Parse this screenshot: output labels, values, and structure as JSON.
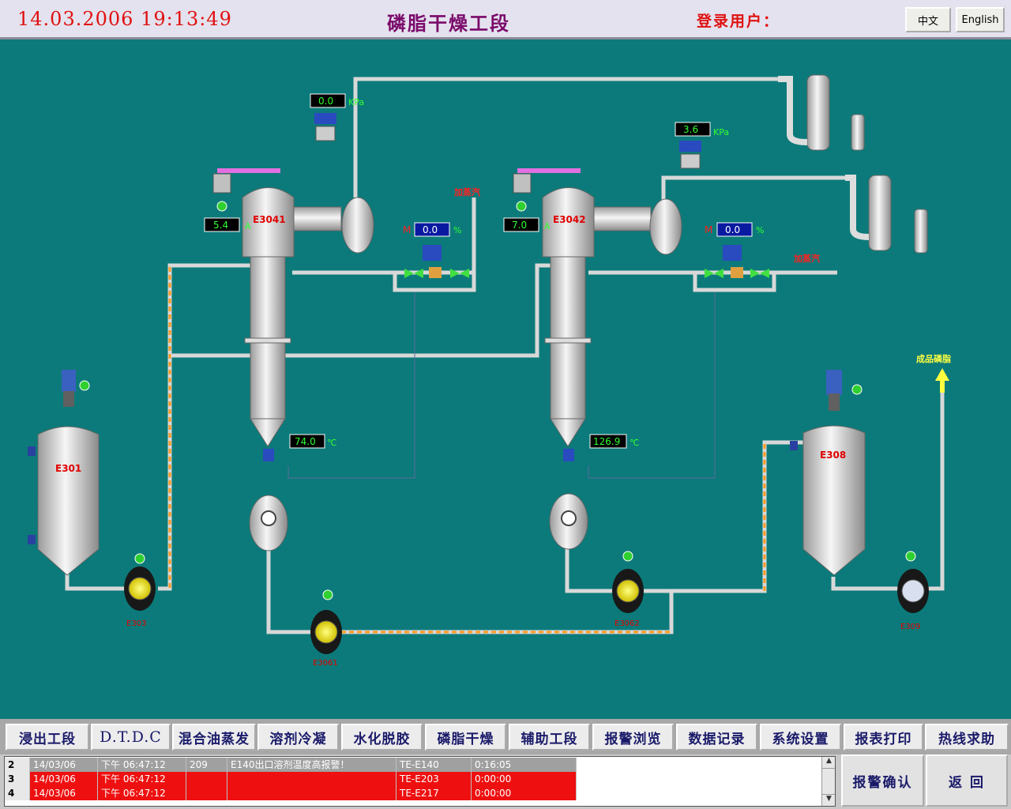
{
  "header": {
    "datetime": "14.03.2006   19:13:49",
    "title": "磷脂干燥工段",
    "login_label": "登录用户：",
    "lang_cn": "中文",
    "lang_en": "English"
  },
  "process": {
    "tanks": {
      "e301": "E301",
      "e308": "E308"
    },
    "dryers": {
      "e3041": "E3041",
      "e3042": "E3042"
    },
    "pumps": {
      "p1": "E303",
      "p2": "E3061",
      "p3": "E3062",
      "p4": "E309"
    },
    "readings": {
      "pressure1": "0.0",
      "pressure1_unit": "KPa",
      "pressure2": "3.6",
      "pressure2_unit": "KPa",
      "current1": "5.4",
      "current1_unit": "A",
      "current2": "7.0",
      "current2_unit": "A",
      "valve1": "0.0",
      "valve1_unit": "%",
      "valve1_tag": "M",
      "valve2": "0.0",
      "valve2_unit": "%",
      "valve2_tag": "M",
      "temp1": "74.0",
      "temp1_unit": "℃",
      "temp2": "126.9",
      "temp2_unit": "℃"
    },
    "labels": {
      "steam1": "加蒸汽",
      "steam2": "加蒸汽",
      "product": "成品磷脂"
    }
  },
  "nav": {
    "items": [
      "浸出工段",
      "D.T.D.C",
      "混合油蒸发",
      "溶剂冷凝",
      "水化脱胶",
      "磷脂干燥",
      "辅助工段",
      "报警浏览",
      "数据记录",
      "系统设置",
      "报表打印",
      "热线求助"
    ]
  },
  "alarms": [
    {
      "idx": "2",
      "date": "14/03/06",
      "time": "下午 06:47:12",
      "code": "209",
      "message": "E140出口溶剂温度高报警！",
      "tag": "TE-E140",
      "duration": "0:16:05"
    },
    {
      "idx": "3",
      "date": "14/03/06",
      "time": "下午 06:47:12",
      "code": "",
      "message": "",
      "tag": "TE-E203",
      "duration": "0:00:00"
    },
    {
      "idx": "4",
      "date": "14/03/06",
      "time": "下午 06:47:12",
      "code": "",
      "message": "",
      "tag": "TE-E217",
      "duration": "0:00:00"
    }
  ],
  "alarm_buttons": {
    "confirm": "报警确认",
    "back": "返 回"
  },
  "colors": {
    "process_bg": "#0c7a7a",
    "alarm_row": "#ee1010",
    "alarm_row_old": "#a0a0a0",
    "header_text": "#e01010"
  }
}
